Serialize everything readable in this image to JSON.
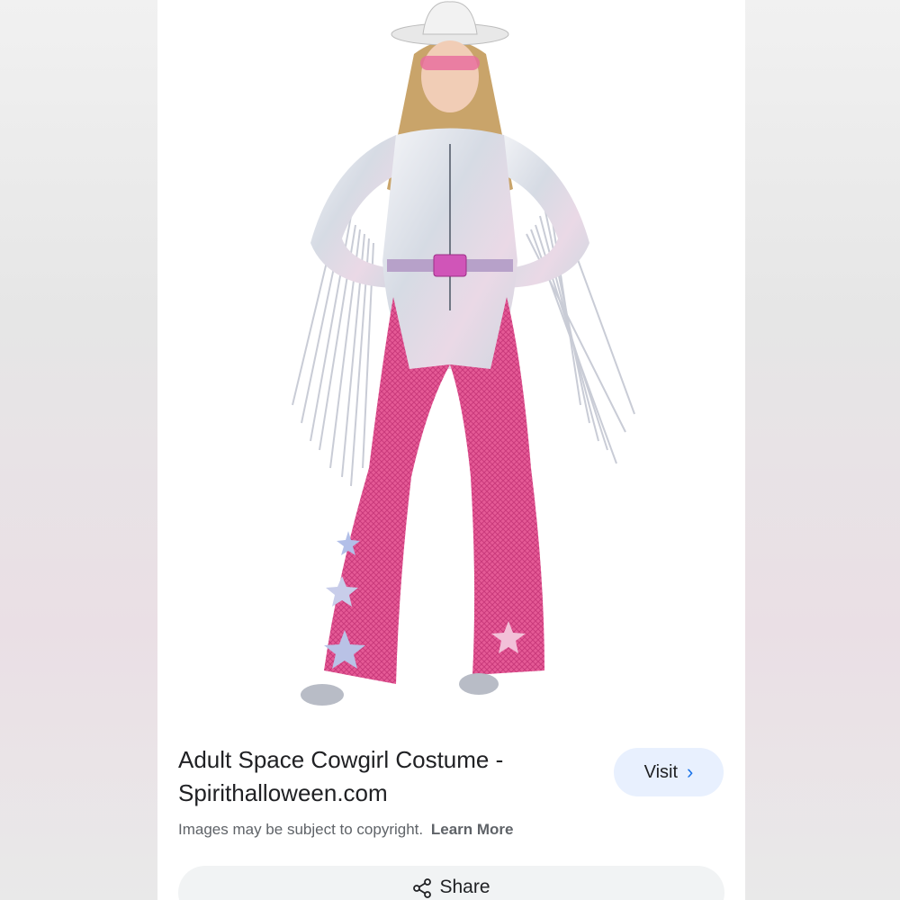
{
  "result": {
    "title_line1": "Adult Space Cowgirl Costume -",
    "title_line2": "Spirithalloween.com",
    "visit_label": "Visit",
    "copyright_text": "Images may be subject to copyright.",
    "learn_more_label": "Learn More",
    "share_label": "Share"
  },
  "colors": {
    "visit_bg": "#e8f0fe",
    "accent": "#1a73e8",
    "share_bg": "#f1f3f4",
    "costume_pink": "#e0508f",
    "costume_silver": "#d9dde3"
  },
  "icons": [
    "chevron-right-icon",
    "share-icon"
  ]
}
